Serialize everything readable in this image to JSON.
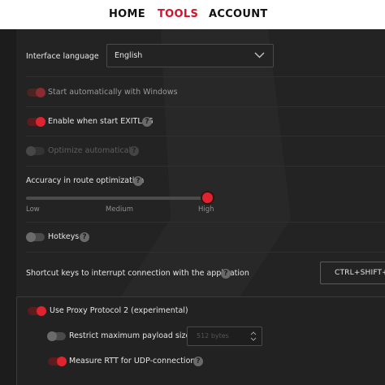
{
  "nav": {
    "items": [
      "HOME",
      "TOOLS",
      "ACCOUNT"
    ],
    "active": "TOOLS"
  },
  "settings": {
    "interface_language": {
      "label": "Interface language",
      "value": "English"
    },
    "start_automatically": {
      "label": "Start automatically with Windows",
      "state": "on-dim"
    },
    "enable_on_start": {
      "label": "Enable when start EXITLAG",
      "state": "on"
    },
    "optimize_automatically": {
      "label": "Optimize automatically",
      "state": "disabled"
    },
    "accuracy": {
      "label": "Accuracy in route optimization",
      "ticks": [
        "Low",
        "Medium",
        "High"
      ],
      "value": "High"
    },
    "hotkeys": {
      "label": "Hotkeys",
      "state": "off"
    },
    "shortcut": {
      "label": "Shortcut keys to interrupt connection with the application",
      "value": "CTRL+SHIFT+Q"
    },
    "proxy_protocol": {
      "label": "Use Proxy Protocol 2 (experimental)",
      "state": "on"
    },
    "max_payload": {
      "label": "Restrict maximum payload size",
      "state": "off",
      "value": "512 bytes"
    },
    "measure_rtt": {
      "label": "Measure RTT for UDP-connections",
      "state": "on"
    }
  },
  "icons": {
    "help": "question-mark-icon",
    "dropdown": "chevron-down-icon",
    "stepper": "up-down-stepper-icon"
  },
  "colors": {
    "accent": "#d3122b",
    "toggle_on": "#e0242f",
    "background": "#232323",
    "nav_bg": "#ffffff"
  },
  "help_glyph": "?"
}
